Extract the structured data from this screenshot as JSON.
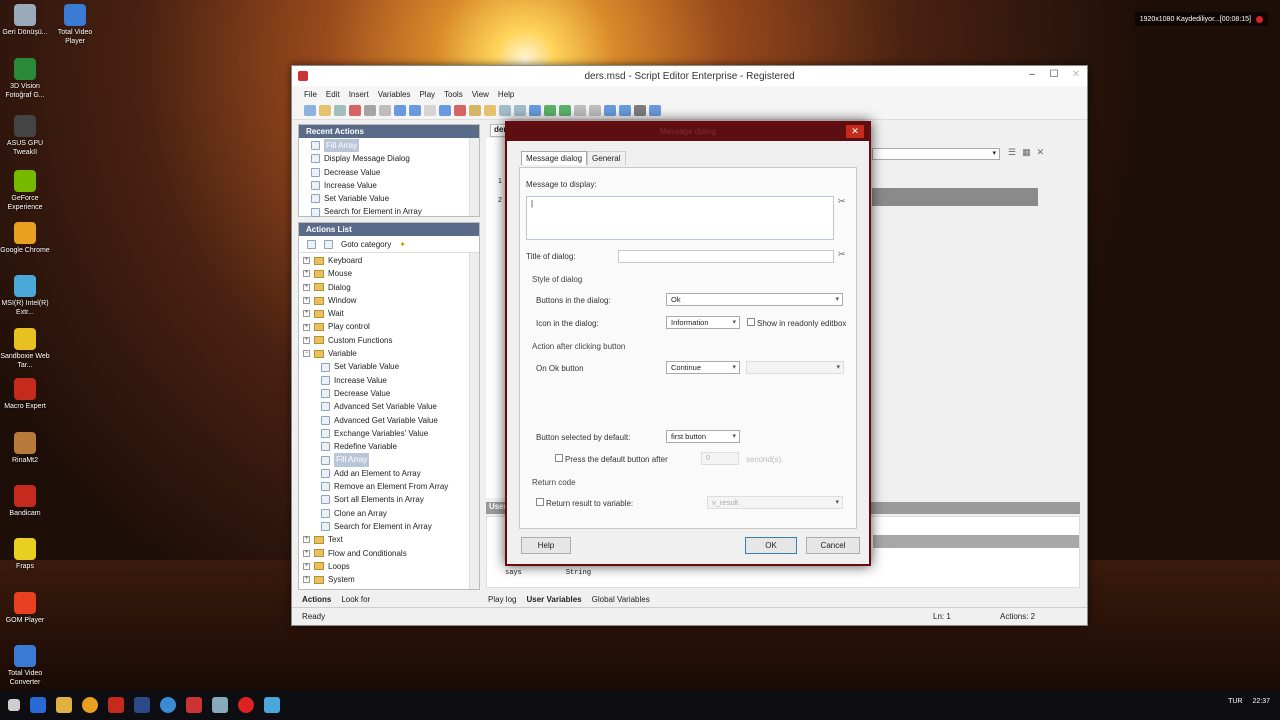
{
  "desktop": {
    "icons": [
      {
        "label": "Geri Dönüşü...",
        "color": "#9ab"
      },
      {
        "label": "Total Video Player",
        "color": "#3a7bd5"
      },
      {
        "label": "3D Vision Fotoğraf G...",
        "color": "#2a8a3a"
      },
      {
        "label": "ASUS GPU TweakII",
        "color": "#444"
      },
      {
        "label": "GeForce Experience",
        "color": "#76b900"
      },
      {
        "label": "Google Chrome",
        "color": "#e8a020"
      },
      {
        "label": "MSI(R) Intel(R) Extr...",
        "color": "#4aa8d8"
      },
      {
        "label": "Sandboxie Web Tar...",
        "color": "#e8c020"
      },
      {
        "label": "Macro Expert",
        "color": "#c42b1c"
      },
      {
        "label": "RinaMt2",
        "color": "#b87a3a"
      },
      {
        "label": "Bandicam",
        "color": "#c42b1c"
      },
      {
        "label": "Fraps",
        "color": "#e8d020"
      },
      {
        "label": "GOM Player",
        "color": "#e84020"
      },
      {
        "label": "Total Video Converter",
        "color": "#3a7bd5"
      }
    ],
    "tray_text": "1920x1080 Kaydediliyor...[00:08:15]"
  },
  "window": {
    "title": "ders.msd - Script Editor  Enterprise - Registered",
    "menu": [
      "File",
      "Edit",
      "Insert",
      "Variables",
      "Play",
      "Tools",
      "View",
      "Help"
    ],
    "status_left": "Ready",
    "status_ln": "Ln: 1",
    "status_actions": "Actions: 2"
  },
  "recent": {
    "header": "Recent Actions",
    "items": [
      "Fill Array",
      "Display Message Dialog",
      "Decrease Value",
      "Increase Value",
      "Set Variable Value",
      "Search for Element in Array"
    ]
  },
  "actions_list": {
    "header": "Actions List",
    "goto": "Goto category",
    "tree": [
      {
        "label": "Keyboard",
        "level": 0,
        "expander": "+"
      },
      {
        "label": "Mouse",
        "level": 0,
        "expander": "+"
      },
      {
        "label": "Dialog",
        "level": 0,
        "expander": "+"
      },
      {
        "label": "Window",
        "level": 0,
        "expander": "+"
      },
      {
        "label": "Wait",
        "level": 0,
        "expander": "+"
      },
      {
        "label": "Play control",
        "level": 0,
        "expander": "+"
      },
      {
        "label": "Custom Functions",
        "level": 0,
        "expander": "+"
      },
      {
        "label": "Variable",
        "level": 0,
        "expander": "−"
      },
      {
        "label": "Set Variable Value",
        "level": 1
      },
      {
        "label": "Increase Value",
        "level": 1
      },
      {
        "label": "Decrease Value",
        "level": 1
      },
      {
        "label": "Advanced Set Variable Value",
        "level": 1
      },
      {
        "label": "Advanced Get Variable Value",
        "level": 1
      },
      {
        "label": "Exchange Variables' Value",
        "level": 1
      },
      {
        "label": "Redefine Variable",
        "level": 1
      },
      {
        "label": "Fill Array",
        "level": 1,
        "selected": true
      },
      {
        "label": "Add an Element to Array",
        "level": 1
      },
      {
        "label": "Remove an Element From Array",
        "level": 1
      },
      {
        "label": "Sort all Elements in Array",
        "level": 1
      },
      {
        "label": "Clone an Array",
        "level": 1
      },
      {
        "label": "Search for Element in Array",
        "level": 1
      },
      {
        "label": "Text",
        "level": 0,
        "expander": "+"
      },
      {
        "label": "Flow and Conditionals",
        "level": 0,
        "expander": "+"
      },
      {
        "label": "Loops",
        "level": 0,
        "expander": "+"
      },
      {
        "label": "System",
        "level": 0,
        "expander": "+"
      }
    ],
    "tabs": [
      "Actions",
      "Look for"
    ]
  },
  "editor": {
    "tab_label": "der",
    "line_numbers": [
      "1",
      "2"
    ],
    "user_label": "User",
    "var_row": [
      "says",
      "String"
    ],
    "bottom_tabs": [
      "Play log",
      "User Variables",
      "Global Variables"
    ]
  },
  "dialog": {
    "title": "Message dialog",
    "tabs": [
      "Message dialog",
      "General"
    ],
    "message_label": "Message to display:",
    "message_value": "|",
    "title_label": "Title of dialog:",
    "title_value": "",
    "style_group": "Style of dialog",
    "buttons_label": "Buttons in the dialog:",
    "buttons_value": "Ok",
    "icon_label": "Icon in the dialog:",
    "icon_value": "Information",
    "readonly_label": "Show in readonly editbox",
    "action_group": "Action after clicking button",
    "onok_label": "On Ok button",
    "onok_value": "Continue",
    "onok_extra": "",
    "default_label": "Button selected by default:",
    "default_value": "first button",
    "press_label": "Press the default button after",
    "press_value": "0",
    "press_unit": "second(s).",
    "return_group": "Return code",
    "return_label": "Return result to variable:",
    "return_value": "v_result",
    "help": "Help",
    "ok": "OK",
    "cancel": "Cancel"
  },
  "taskbar": {
    "lang": "TUR",
    "time": "22:37"
  }
}
